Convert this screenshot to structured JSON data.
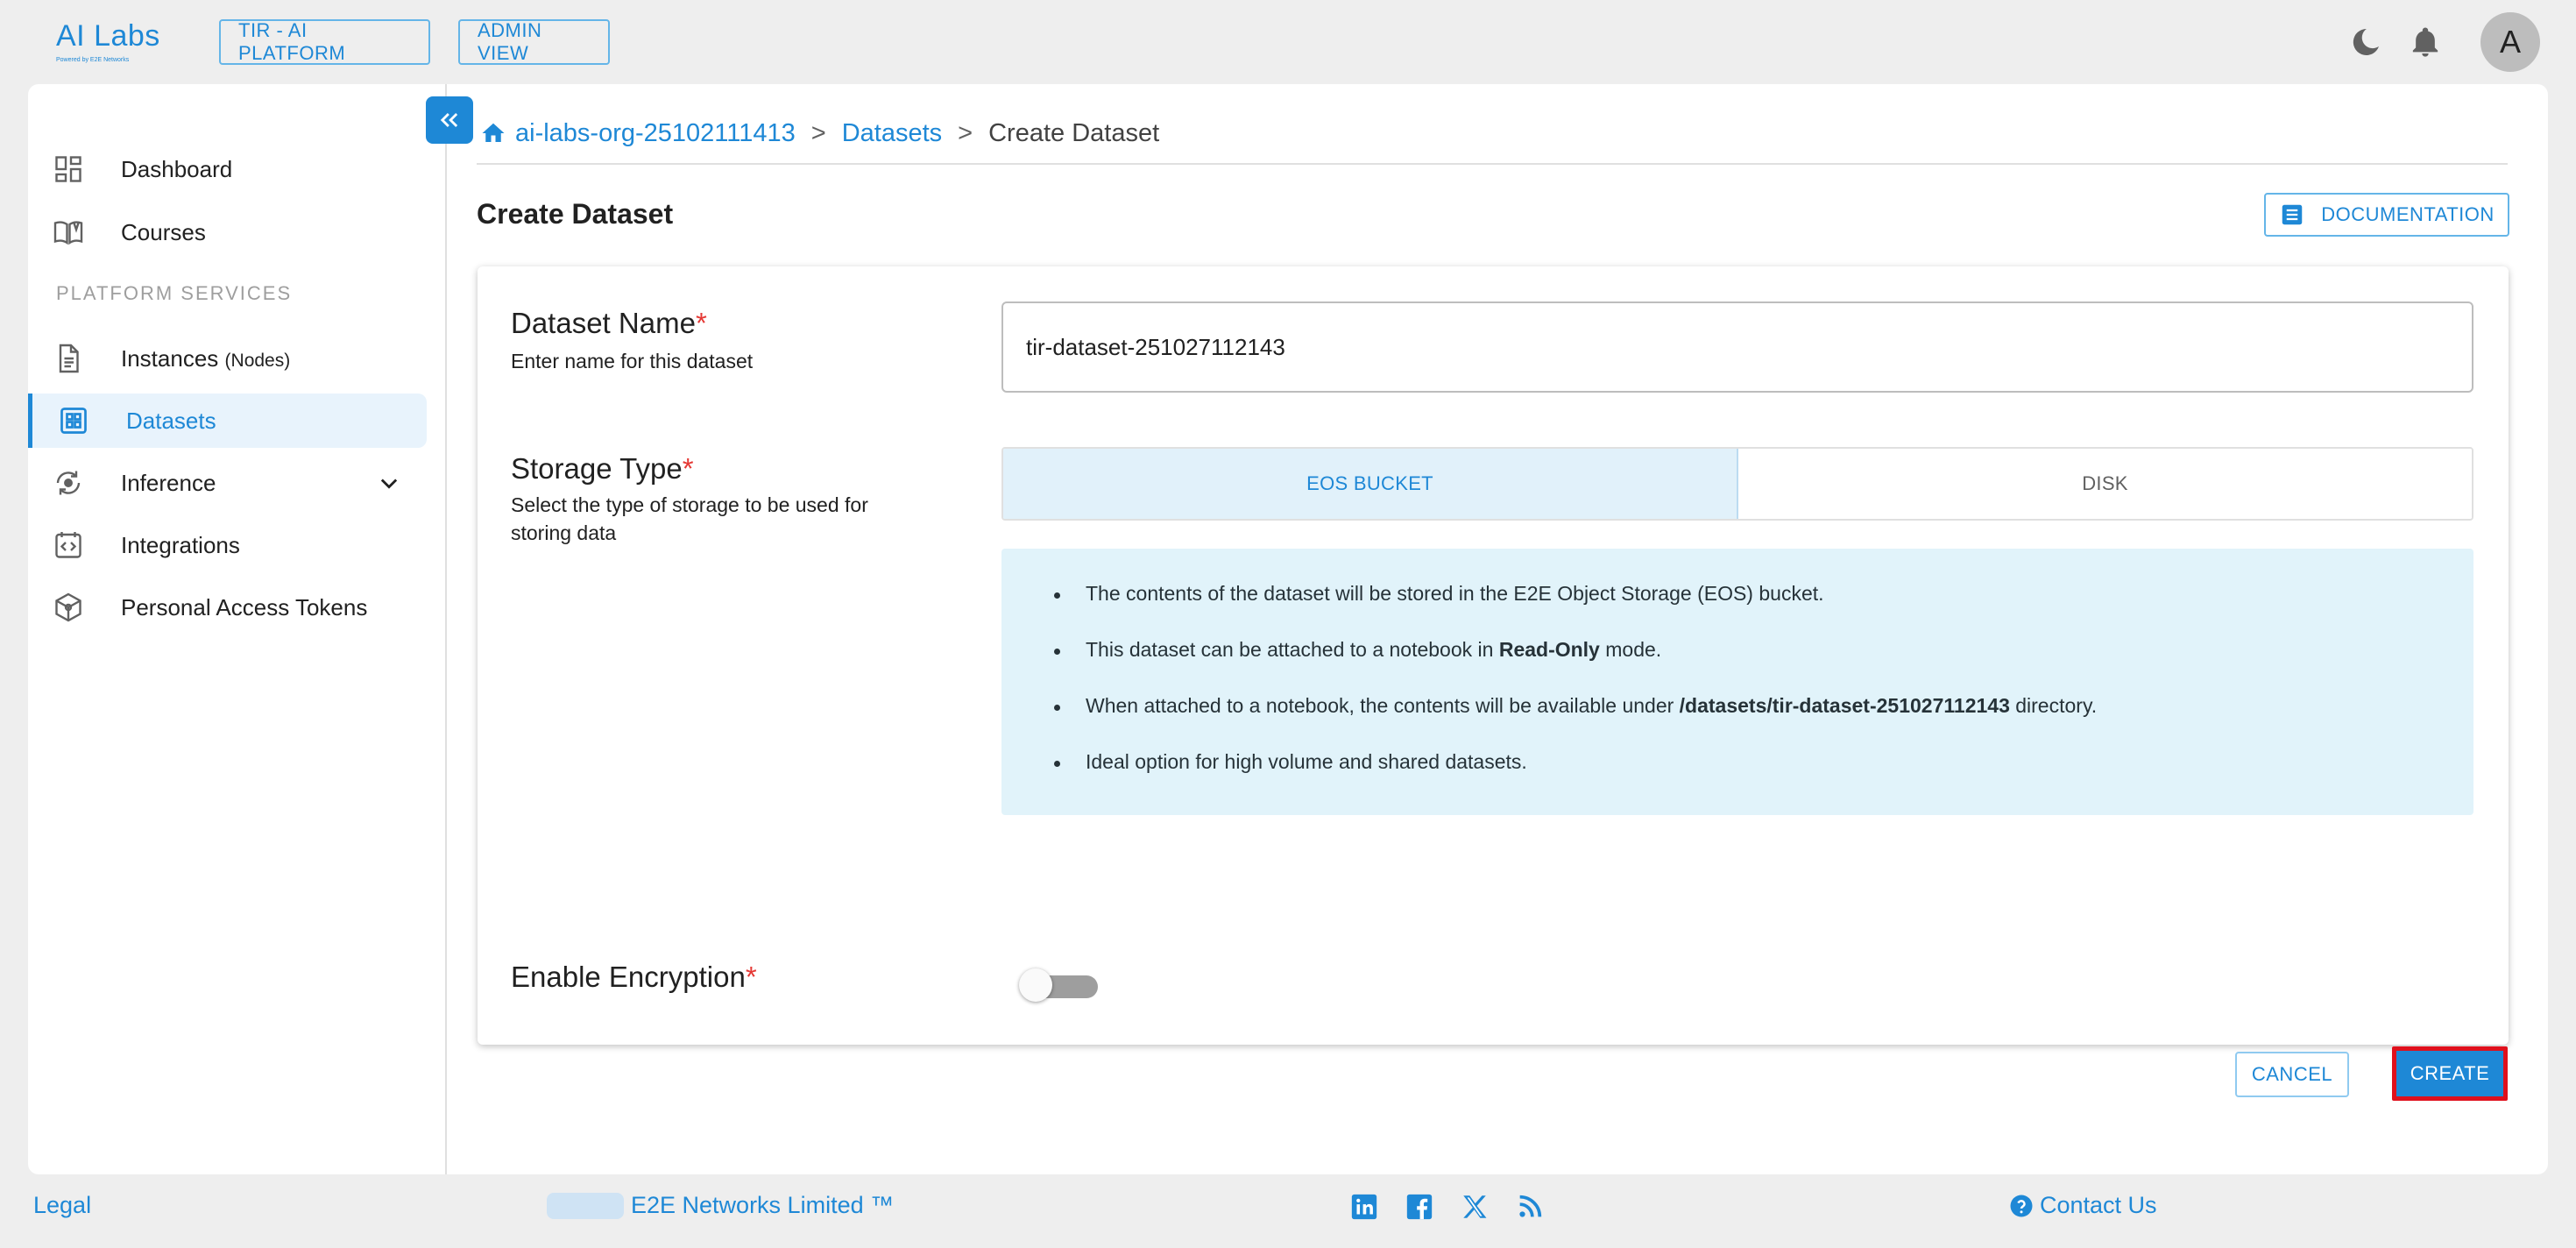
{
  "brand": {
    "logo_text": "AI Labs",
    "logo_sub": "Powered by E2E Networks"
  },
  "top_nav": {
    "platform_button": "TIR - AI PLATFORM",
    "admin_button": "ADMIN VIEW",
    "avatar_initial": "A"
  },
  "sidebar": {
    "items": [
      {
        "label": "Dashboard",
        "icon": "dashboard-icon"
      },
      {
        "label": "Courses",
        "icon": "book-icon"
      }
    ],
    "section_title": "PLATFORM SERVICES",
    "services": [
      {
        "label": "Instances",
        "suffix": "(Nodes)",
        "icon": "document-icon"
      },
      {
        "label": "Datasets",
        "icon": "grid-icon",
        "active": true
      },
      {
        "label": "Inference",
        "icon": "inference-icon",
        "expandable": true
      },
      {
        "label": "Integrations",
        "icon": "code-icon"
      },
      {
        "label": "Personal Access Tokens",
        "icon": "cube-icon"
      }
    ]
  },
  "breadcrumb": {
    "org": "ai-labs-org-25102111413",
    "datasets": "Datasets",
    "current": "Create Dataset",
    "separator": ">"
  },
  "page": {
    "title": "Create Dataset",
    "documentation_button": "DOCUMENTATION"
  },
  "form": {
    "dataset_name": {
      "label": "Dataset Name",
      "required_mark": "*",
      "help": "Enter name for this dataset",
      "value": "tir-dataset-251027112143"
    },
    "storage_type": {
      "label": "Storage Type",
      "required_mark": "*",
      "help": "Select the type of storage to be used for storing data",
      "options": [
        "EOS BUCKET",
        "DISK"
      ],
      "selected": "EOS BUCKET"
    },
    "info": {
      "line1": "The contents of the dataset will be stored in the E2E Object Storage (EOS) bucket.",
      "line2_pre": "This dataset can be attached to a notebook in ",
      "line2_bold": "Read-Only",
      "line2_post": " mode.",
      "line3_pre": "When attached to a notebook, the contents will be available under ",
      "line3_bold": "/datasets/tir-dataset-251027112143",
      "line3_post": " directory.",
      "line4": "Ideal option for high volume and shared datasets."
    },
    "encryption": {
      "label": "Enable Encryption",
      "required_mark": "*",
      "enabled": false
    },
    "cancel_button": "CANCEL",
    "create_button": "CREATE"
  },
  "footer": {
    "legal": "Legal",
    "copyright": "E2E Networks Limited ™",
    "social": [
      "linkedin-icon",
      "facebook-icon",
      "x-icon",
      "rss-icon"
    ],
    "contact": "Contact Us"
  },
  "colors": {
    "accent": "#1e88d6",
    "required": "#e53935",
    "highlight_border": "#e0101c",
    "info_bg": "#e1f3fa"
  }
}
